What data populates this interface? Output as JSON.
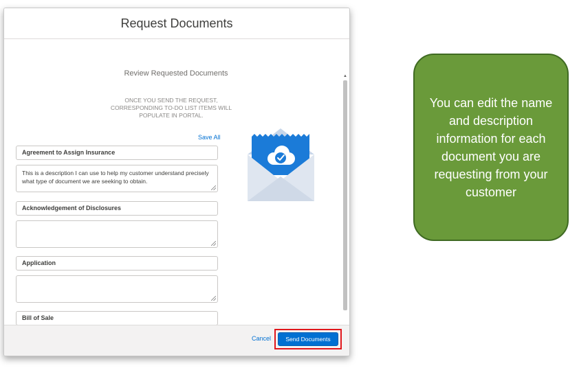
{
  "modal": {
    "title": "Request Documents",
    "section_title": "Review Requested Documents",
    "info_text": "ONCE YOU SEND THE REQUEST, CORRESPONDING TO-DO LIST ITEMS WILL POPULATE IN PORTAL.",
    "save_all_label": "Save All",
    "documents": [
      {
        "name": "Agreement to Assign Insurance",
        "description": "This is a description I can use to help my customer understand precisely what type of document we are seeking to obtain."
      },
      {
        "name": "Acknowledgement of Disclosures",
        "description": ""
      },
      {
        "name": "Application",
        "description": ""
      },
      {
        "name": "Bill of Sale",
        "description": ""
      }
    ],
    "envelope_icon": "envelope-cloud-check-icon",
    "footer": {
      "cancel_label": "Cancel",
      "send_label": "Send Documents"
    }
  },
  "callout": {
    "text": "You can edit the name and description information for each document you are requesting from your customer"
  },
  "colors": {
    "brand_blue": "#0070d2",
    "callout_green": "#6a9a3a",
    "highlight_red": "#e0161b"
  }
}
